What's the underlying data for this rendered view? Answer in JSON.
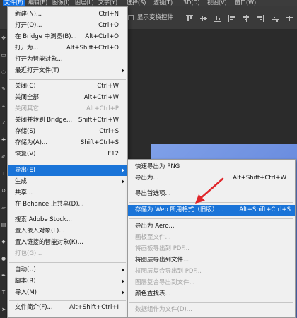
{
  "menubar": {
    "items": [
      {
        "label": "文件(F)",
        "active": true
      },
      {
        "label": "编辑(E)",
        "active": false
      },
      {
        "label": "图像(I)",
        "active": false
      },
      {
        "label": "图层(L)",
        "active": false
      },
      {
        "label": "文字(Y)",
        "active": false
      },
      {
        "label": "选择(S)",
        "active": false
      },
      {
        "label": "滤镜(T)",
        "active": false
      },
      {
        "label": "3D(D)",
        "active": false
      },
      {
        "label": "视图(V)",
        "active": false
      },
      {
        "label": "窗口(W)",
        "active": false
      }
    ]
  },
  "options_bar": {
    "show_transform_controls": "显示变换控件",
    "show_transform_checked": false
  },
  "file_menu": {
    "items": [
      {
        "label": "新建(N)...",
        "shortcut": "Ctrl+N"
      },
      {
        "label": "打开(O)...",
        "shortcut": "Ctrl+O"
      },
      {
        "label": "在 Bridge 中浏览(B)...",
        "shortcut": "Alt+Ctrl+O"
      },
      {
        "label": "打开为...",
        "shortcut": "Alt+Shift+Ctrl+O"
      },
      {
        "label": "打开为智能对象...",
        "shortcut": ""
      },
      {
        "label": "最近打开文件(T)",
        "shortcut": ""
      },
      {
        "label": "关闭(C)",
        "shortcut": "Ctrl+W"
      },
      {
        "label": "关闭全部",
        "shortcut": "Alt+Ctrl+W"
      },
      {
        "label": "关闭其它",
        "shortcut": "Alt+Ctrl+P"
      },
      {
        "label": "关闭并转到 Bridge...",
        "shortcut": "Shift+Ctrl+W"
      },
      {
        "label": "存储(S)",
        "shortcut": "Ctrl+S"
      },
      {
        "label": "存储为(A)...",
        "shortcut": "Shift+Ctrl+S"
      },
      {
        "label": "恢复(V)",
        "shortcut": "F12"
      },
      {
        "label": "导出(E)",
        "shortcut": ""
      },
      {
        "label": "生成",
        "shortcut": ""
      },
      {
        "label": "共享...",
        "shortcut": ""
      },
      {
        "label": "在 Behance 上共享(D)...",
        "shortcut": ""
      },
      {
        "label": "搜索 Adobe Stock...",
        "shortcut": ""
      },
      {
        "label": "置入嵌入对象(L)...",
        "shortcut": ""
      },
      {
        "label": "置入链接的智能对象(K)...",
        "shortcut": ""
      },
      {
        "label": "打包(G)...",
        "shortcut": ""
      },
      {
        "label": "自动(U)",
        "shortcut": ""
      },
      {
        "label": "脚本(R)",
        "shortcut": ""
      },
      {
        "label": "导入(M)",
        "shortcut": ""
      },
      {
        "label": "文件简介(F)...",
        "shortcut": "Alt+Shift+Ctrl+I"
      }
    ]
  },
  "export_submenu": {
    "items": [
      {
        "label": "快速导出为 PNG",
        "shortcut": ""
      },
      {
        "label": "导出为...",
        "shortcut": "Alt+Shift+Ctrl+W"
      },
      {
        "label": "导出首选项...",
        "shortcut": ""
      },
      {
        "label": "存储为 Web 所用格式（旧版）...",
        "shortcut": "Alt+Shift+Ctrl+S"
      },
      {
        "label": "导出为 Aero...",
        "shortcut": ""
      },
      {
        "label": "画板至文件...",
        "shortcut": ""
      },
      {
        "label": "将画板导出到 PDF...",
        "shortcut": ""
      },
      {
        "label": "将图层导出到文件...",
        "shortcut": ""
      },
      {
        "label": "将图层复合导出到 PDF...",
        "shortcut": ""
      },
      {
        "label": "图层复合导出到文件...",
        "shortcut": ""
      },
      {
        "label": "颜色查找表...",
        "shortcut": ""
      },
      {
        "label": "数据组作为文件(D)...",
        "shortcut": ""
      }
    ]
  },
  "colors": {
    "highlight": "#1a74d8",
    "annotation_arrow": "#e0262b",
    "document_fill": "#6d8fe0"
  }
}
